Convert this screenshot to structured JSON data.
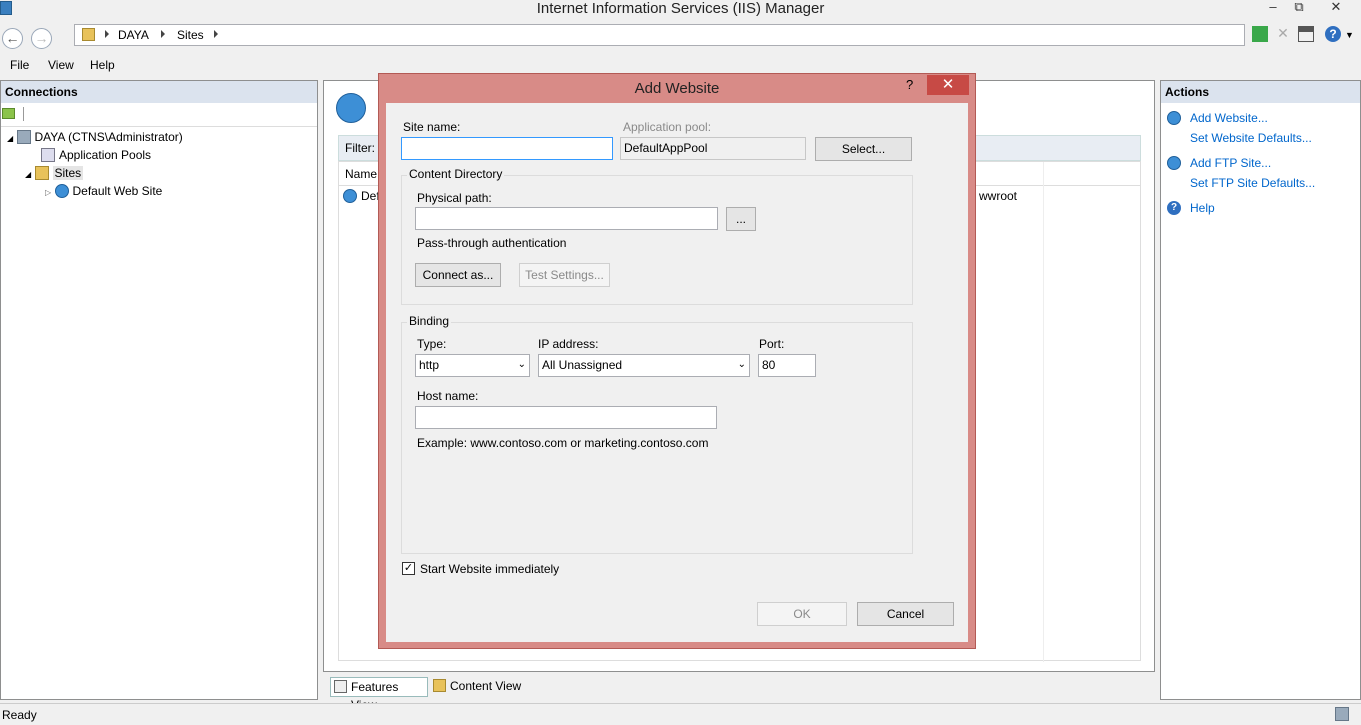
{
  "window": {
    "title": "Internet Information Services (IIS) Manager",
    "minimize": "‒",
    "restore": "⧉",
    "close": "✕"
  },
  "address": {
    "crumbs": [
      "DAYA",
      "Sites"
    ]
  },
  "menu": [
    "File",
    "View",
    "Help"
  ],
  "connections": {
    "header": "Connections",
    "tree": [
      "DAYA (CTNS\\Administrator)",
      "Application Pools",
      "Sites",
      "Default Web Site"
    ]
  },
  "main": {
    "filter_label": "Filter:",
    "col_name": "Name",
    "row_name_partial": "Def",
    "row_path_partial": "wwroot"
  },
  "bottom_tabs": [
    "Features View",
    "Content View"
  ],
  "actions": {
    "header": "Actions",
    "items": [
      "Add Website...",
      "Set Website Defaults...",
      "Add FTP Site...",
      "Set FTP Site Defaults...",
      "Help"
    ]
  },
  "status": "Ready",
  "dialog": {
    "title": "Add Website",
    "help_glyph": "?",
    "close_glyph": "✕",
    "site_name_label": "Site name:",
    "site_name_value": "",
    "app_pool_label": "Application pool:",
    "app_pool_value": "DefaultAppPool",
    "select_button": "Select...",
    "content_dir_label": "Content Directory",
    "physical_path_label": "Physical path:",
    "physical_path_value": "",
    "browse_button": "...",
    "passthrough_label": "Pass-through authentication",
    "connect_as_button": "Connect as...",
    "test_settings_button": "Test Settings...",
    "binding_label": "Binding",
    "type_label": "Type:",
    "type_value": "http",
    "ip_label": "IP address:",
    "ip_value": "All Unassigned",
    "port_label": "Port:",
    "port_value": "80",
    "host_label": "Host name:",
    "host_value": "",
    "example_text": "Example: www.contoso.com or marketing.contoso.com",
    "start_checkbox_label": "Start Website immediately",
    "start_checked": true,
    "ok_button": "OK",
    "cancel_button": "Cancel"
  },
  "colors": {
    "dialog_frame": "#d88b87",
    "close_button": "#c74a45",
    "panel_header": "#dbe3ee",
    "link": "#0066cc"
  }
}
